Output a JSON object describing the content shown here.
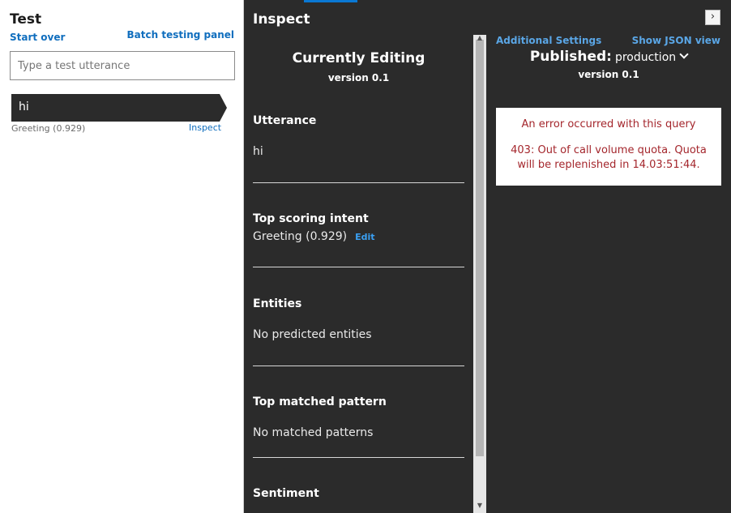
{
  "test_panel": {
    "title": "Test",
    "start_over": "Start over",
    "batch_testing": "Batch testing panel",
    "input_placeholder": "Type a test utterance",
    "results": [
      {
        "utterance": "hi",
        "intent": "Greeting (0.929)",
        "inspect": "Inspect"
      }
    ]
  },
  "inspect": {
    "title": "Inspect",
    "currently_editing": "Currently Editing",
    "version": "version 0.1",
    "sections": {
      "utterance": {
        "title": "Utterance",
        "value": "hi"
      },
      "top_intent": {
        "title": "Top scoring intent",
        "value": "Greeting (0.929)",
        "edit": "Edit"
      },
      "entities": {
        "title": "Entities",
        "value": "No predicted entities"
      },
      "pattern": {
        "title": "Top matched pattern",
        "value": "No matched patterns"
      },
      "sentiment": {
        "title": "Sentiment"
      }
    }
  },
  "published": {
    "additional_settings": "Additional Settings",
    "show_json": "Show JSON view",
    "label": "Published:",
    "environment": "production",
    "version": "version 0.1",
    "error_title": "An error occurred with this query",
    "error_message": "403: Out of call volume quota. Quota will be replenished in 14.03:51:44."
  },
  "colors": {
    "dark_bg": "#2b2b2b",
    "link_blue": "#106ebe",
    "error_red": "#a4262c",
    "accent": "#0a78d4"
  }
}
